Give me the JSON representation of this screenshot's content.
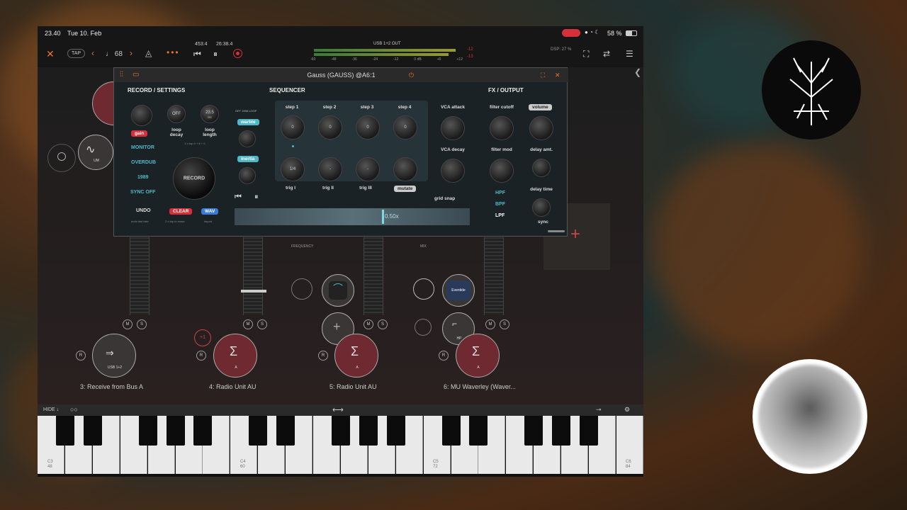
{
  "status": {
    "time": "23.40",
    "date": "Tue 10. Feb",
    "battery": "58 %"
  },
  "topbar": {
    "tap": "TAP",
    "tempo": "♩ 68",
    "position": "453:4",
    "clock": "26:38.4",
    "output": "USB 1+2 OUT",
    "dsp": "DSP: 27 %",
    "meter_ticks": [
      "-60",
      "-48",
      "-36",
      "-24",
      "-12",
      "0 dB",
      "+6",
      "+12"
    ],
    "peak_l": "-12",
    "peak_r": "-13"
  },
  "plugin": {
    "title": "Gauss (GAUSS) @A6:1",
    "record": {
      "heading": "RECORD / SETTINGS",
      "gain": "gain",
      "loop_decay_value": "OFF",
      "loop_decay_label": "loop decay",
      "loop_length_value": "23.5",
      "loop_length_unit": "sec",
      "loop_length_label": "loop length",
      "tap_hint": "2 x tap 0 + 8 + 0",
      "modes": [
        "MONITOR",
        "OVERDUB",
        "1989",
        "SYNC OFF"
      ],
      "record_button": "RECORD",
      "undo": "UNDO",
      "undo_hint": "undo last take",
      "clear": "CLEAR",
      "clear_hint": "2 x tap to erase",
      "wav": "WAV",
      "wav_hint": "import"
    },
    "sequencer": {
      "heading": "SEQUENCER",
      "loop_modes": "OFF 1996 LOOP",
      "warble": "warble",
      "inertia": "inertia",
      "steps": [
        {
          "label": "step 1",
          "value": "0"
        },
        {
          "label": "step 2",
          "value": "0"
        },
        {
          "label": "step 3",
          "value": "0"
        },
        {
          "label": "step 4",
          "value": "0"
        }
      ],
      "trigs": [
        {
          "label": "trig I",
          "value": "1/4"
        },
        {
          "label": "trig II",
          "value": "-"
        },
        {
          "label": "trig III",
          "value": "-"
        },
        {
          "label": "mutate",
          "value": ""
        }
      ],
      "vca_attack": "VCA attack",
      "vca_decay": "VCA decay",
      "grid_snap": "grid snap",
      "speed": "0.50x"
    },
    "fx": {
      "heading": "FX / OUTPUT",
      "filter_cutoff": "filter cutoff",
      "volume": "volume",
      "filter_mod": "filter mod",
      "delay_amt": "delay amt.",
      "filters": [
        "HPF",
        "BPF",
        "LPF"
      ],
      "delay_time": "delay time",
      "sync": "sync"
    }
  },
  "channels": [
    {
      "title": "3: Receive from Bus A",
      "node": "USB 1+2"
    },
    {
      "title": "4: Radio Unit AU",
      "node": "A"
    },
    {
      "title": "5: Radio Unit AU",
      "node": "A"
    },
    {
      "title": "6: MU Waverley (Waver...",
      "node": "A"
    }
  ],
  "workspace": {
    "um": "UM",
    "frequency": "FREQUENCY",
    "mix": "MIX",
    "eventide": "Eventide",
    "hp": "HP",
    "plus_one": "+1",
    "m": "M",
    "s": "S",
    "r": "R"
  },
  "keyboard": {
    "hide": "HIDE ↓",
    "labels": [
      {
        "note": "C3",
        "num": "48"
      },
      {
        "note": "C4",
        "num": "60"
      },
      {
        "note": "C5",
        "num": "72"
      },
      {
        "note": "C6",
        "num": "84"
      }
    ]
  },
  "colors": {
    "accent": "#e8742a",
    "cyan": "#4fb8c8",
    "node_red": "#6e2a30",
    "clear_red": "#d8303a",
    "wav_blue": "#3a7ad8"
  }
}
